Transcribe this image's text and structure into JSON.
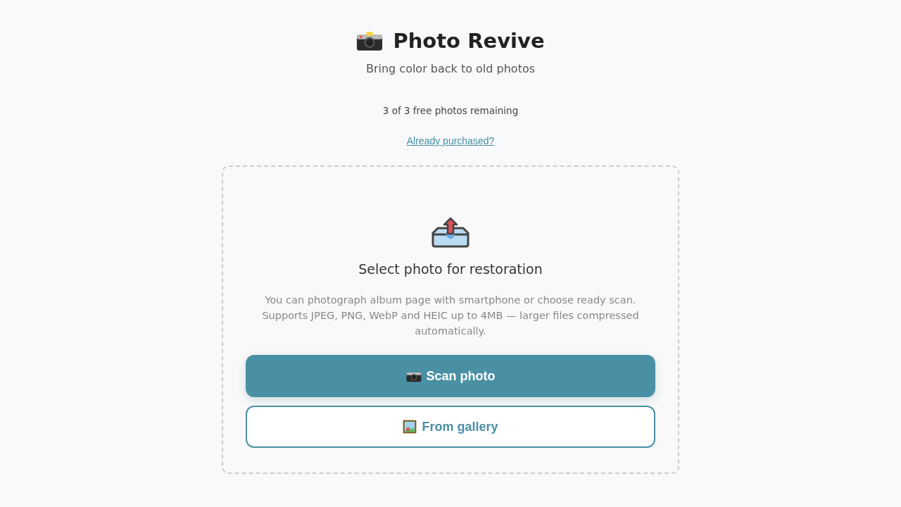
{
  "header": {
    "title": "Photo Revive",
    "subtitle": "Bring color back to old photos"
  },
  "quota": "3 of 3 free photos remaining",
  "restore_link": "Already purchased?",
  "dropzone": {
    "heading": "Select photo for restoration",
    "description": "You can photograph album page with smartphone or choose ready scan. Supports JPEG, PNG, WebP and HEIC up to 4MB — larger files compressed automatically.",
    "buttons": [
      {
        "label": "Scan photo",
        "kind": "primary"
      },
      {
        "label": "From gallery",
        "kind": "outline"
      }
    ]
  }
}
